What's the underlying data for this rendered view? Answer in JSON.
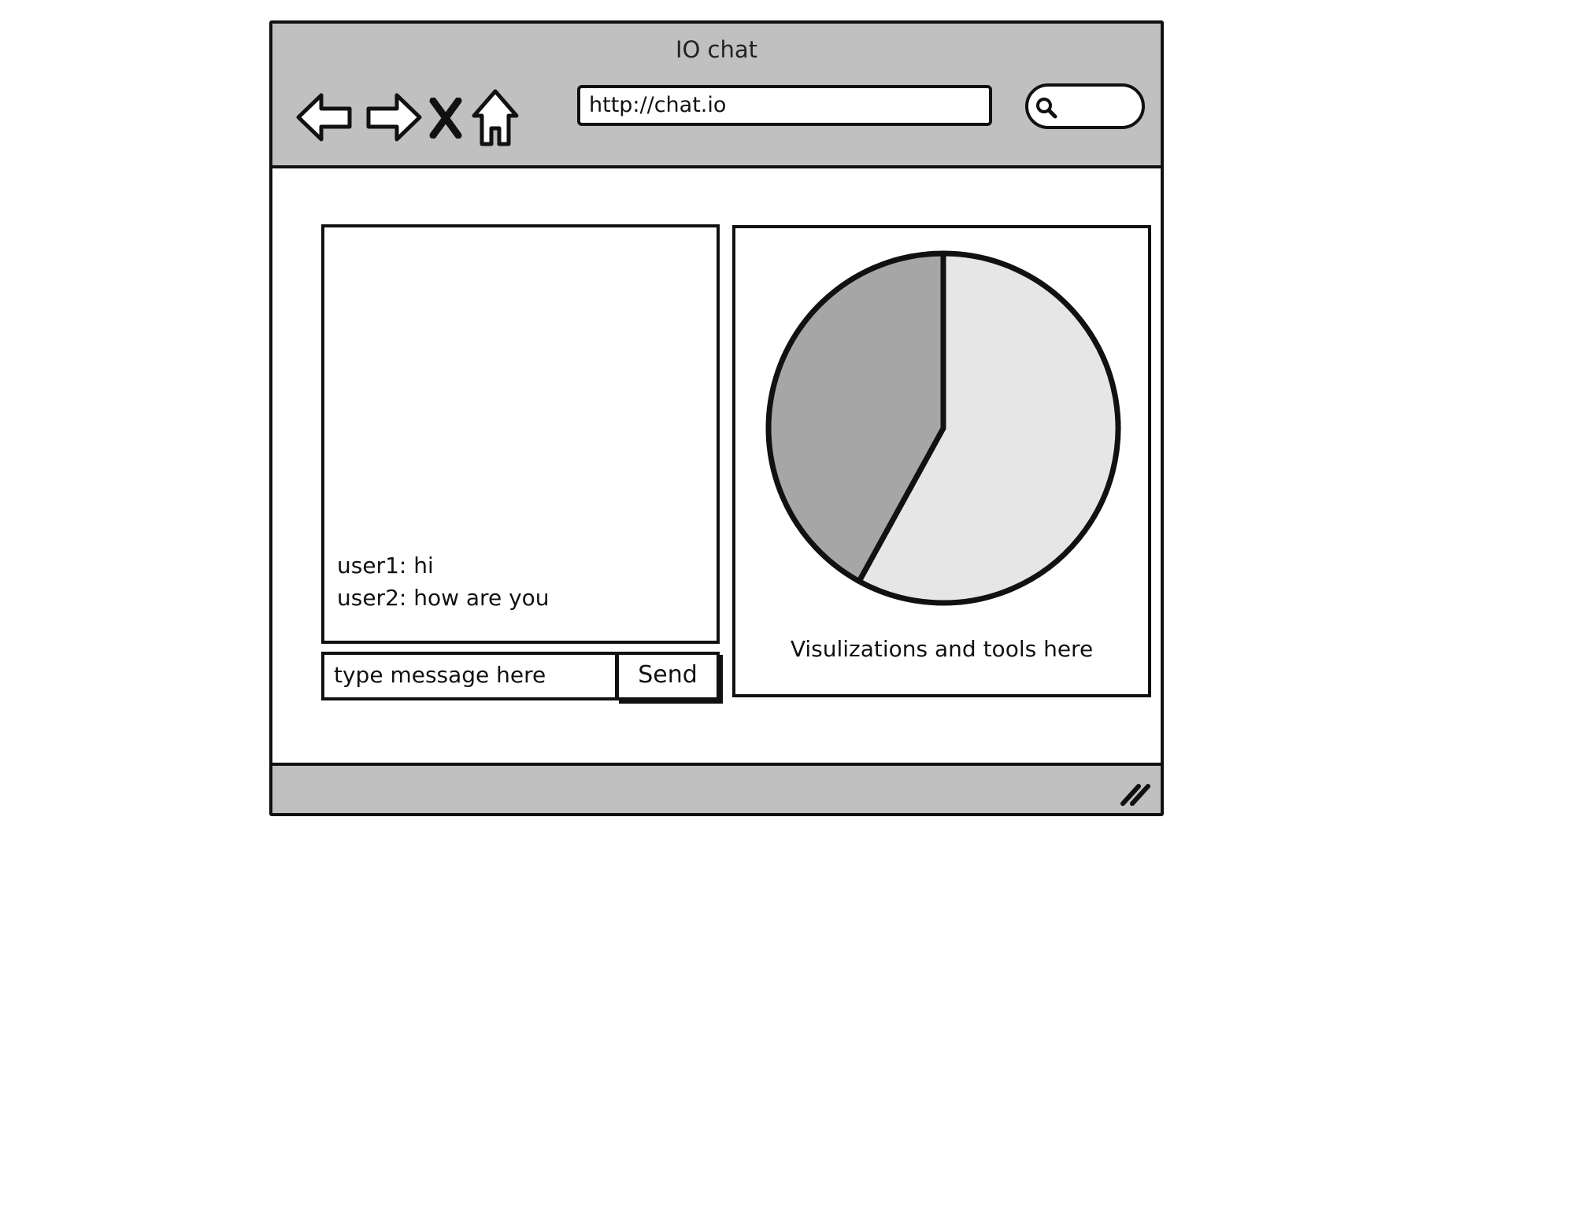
{
  "window": {
    "title": "IO chat"
  },
  "toolbar": {
    "back_icon": "back-arrow-icon",
    "forward_icon": "forward-arrow-icon",
    "stop_icon": "close-icon",
    "home_icon": "home-icon"
  },
  "address_bar": {
    "url": "http://chat.io"
  },
  "search": {
    "icon": "search-icon"
  },
  "chat": {
    "messages": [
      "user1: hi",
      "user2: how are you"
    ],
    "input_placeholder": "type message here",
    "send_label": "Send"
  },
  "visualization": {
    "caption": "Visulizations and tools here",
    "pie": {
      "slices": [
        {
          "share": 0.58,
          "color": "#e6e6e6"
        },
        {
          "share": 0.42,
          "color": "#a6a6a6"
        }
      ],
      "outline_color": "#111111"
    }
  },
  "colors": {
    "chrome": "#c0c0c0",
    "border": "#111111",
    "background": "#ffffff"
  },
  "statusbar": {
    "grip_icon": "resize-grip-icon"
  }
}
